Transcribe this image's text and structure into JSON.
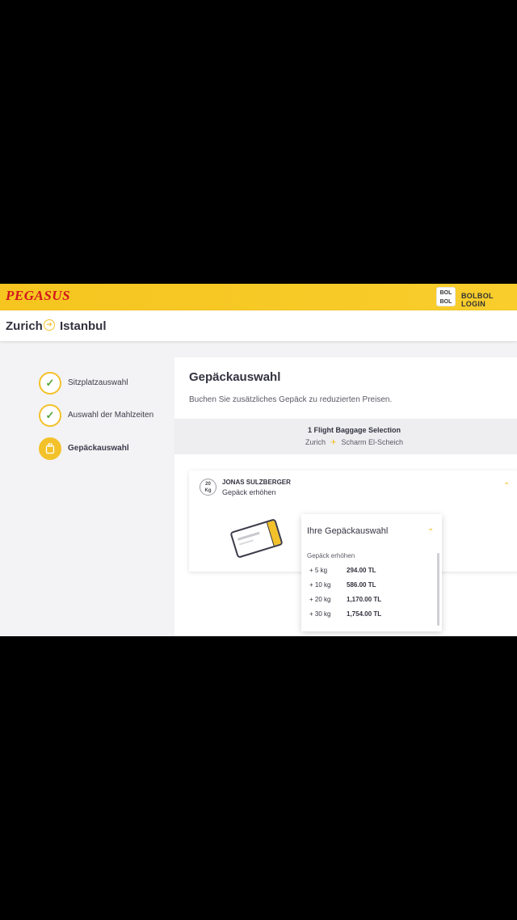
{
  "header": {
    "logo_text": "PEGASUS",
    "bolbol_icon_text": "BOL BOL",
    "login_label": "BOLBOL LOGIN",
    "brand_color": "#f6c51f"
  },
  "route": {
    "from": "Zurich",
    "to": "Istanbul"
  },
  "steps": [
    {
      "label": "Sitzplatzauswahl",
      "state": "done",
      "icon": "check-icon"
    },
    {
      "label": "Auswahl der Mahlzeiten",
      "state": "done",
      "icon": "check-icon"
    },
    {
      "label": "Gepäckauswahl",
      "state": "active",
      "icon": "suitcase-icon"
    }
  ],
  "main": {
    "title": "Gepäckauswahl",
    "subtitle": "Buchen Sie zusätzliches Gepäck zu reduzierten Preisen.",
    "flight": {
      "title": "1 Flight Baggage Selection",
      "origin": "Zurich",
      "destination": "Scharm El-Scheich"
    }
  },
  "passenger": {
    "kg_value": "20",
    "kg_unit": "Kg",
    "name": "JONAS SULZBERGER",
    "subtitle": "Gepäck erhöhen"
  },
  "dropdown": {
    "title": "Ihre Gepäckauswahl",
    "section_label": "Gepäck erhöhen",
    "options": [
      {
        "weight": "+ 5 kg",
        "price": "294.00 TL"
      },
      {
        "weight": "+ 10 kg",
        "price": "586.00 TL"
      },
      {
        "weight": "+ 20 kg",
        "price": "1,170.00 TL"
      },
      {
        "weight": "+ 30 kg",
        "price": "1,754.00 TL"
      }
    ]
  }
}
